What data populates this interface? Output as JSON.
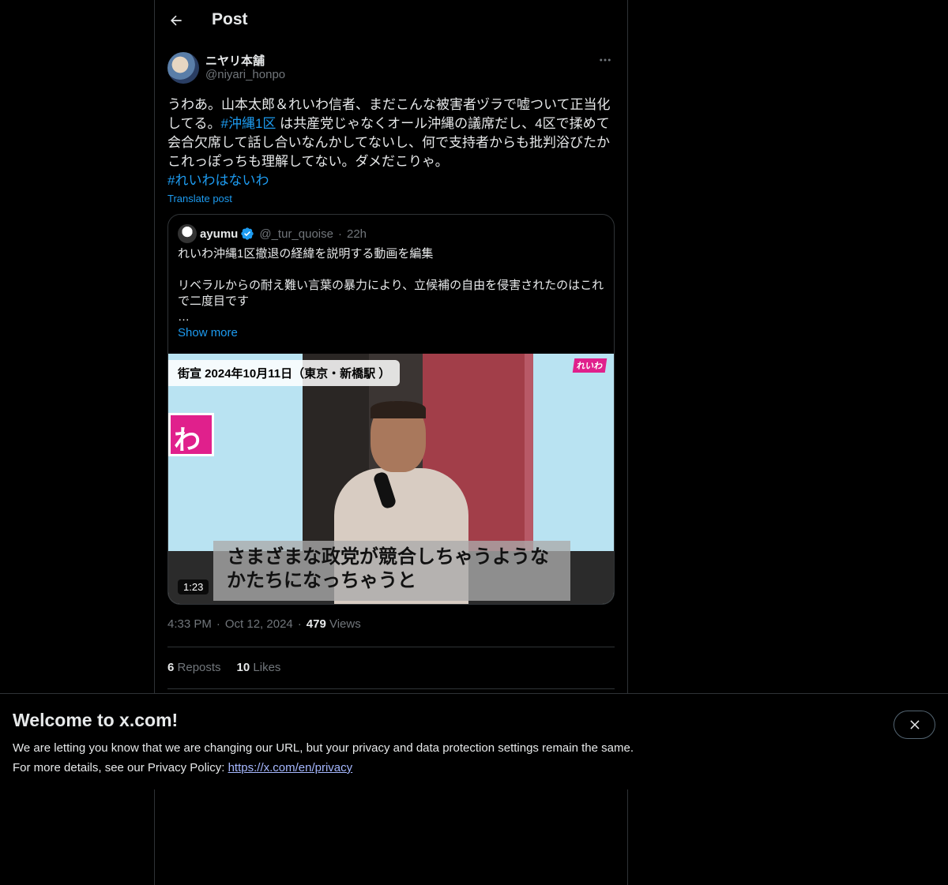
{
  "header": {
    "title": "Post",
    "back_icon": "arrow-left-icon"
  },
  "post": {
    "author_name": "ニヤリ本舗",
    "author_handle": "@niyari_honpo",
    "text_before_tag": "うわあ。山本太郎＆れいわ信者、まだこんな被害者ヅラで嘘ついて正当化してる。",
    "hashtag_1": "#沖縄1区",
    "text_after_tag": " は共産党じゃなくオール沖縄の議席だし、4区で揉めて会合欠席して話し合いなんかしてないし、何で支持者からも批判浴びたかこれっぽっちも理解してない。ダメだこりゃ。",
    "hashtag_2": "#れいわはないわ",
    "translate_label": "Translate post",
    "time": "4:33 PM",
    "date": "Oct 12, 2024",
    "views_count": "479",
    "views_label": "Views",
    "reposts_count": "6",
    "reposts_label": "Reposts",
    "likes_count": "10",
    "likes_label": "Likes"
  },
  "quote": {
    "name": "ayumu",
    "handle": "@_tur_quoise",
    "dot": "·",
    "time": "22h",
    "line1": "れいわ沖縄1区撤退の経緯を説明する動画を編集",
    "line2": "リベラルからの耐え難い言葉の暴力により、立候補の自由を侵害されたのはこれで二度目です",
    "ellipsis": "…",
    "show_more": "Show more",
    "media": {
      "caption_tag": "街宣 2024年10月11日（東京・新橋駅 ）",
      "logo_text": "れいわ",
      "sign_text": "わ",
      "subtitle_line1": "さまざまな政党が競合しちゃうような",
      "subtitle_line2": "かたちになっちゃうと",
      "duration": "1:23"
    }
  },
  "meta_sep": "·",
  "welcome": {
    "title": "Welcome to x.com!",
    "line1": "We are letting you know that we are changing our URL, but your privacy and data protection settings remain the same.",
    "line2_prefix": "For more details, see our Privacy Policy: ",
    "link": "https://x.com/en/privacy"
  },
  "colors": {
    "accent": "#1d9bf0",
    "background": "#000000",
    "text": "#e7e9ea",
    "muted": "#71767b",
    "border": "#2f3336"
  }
}
